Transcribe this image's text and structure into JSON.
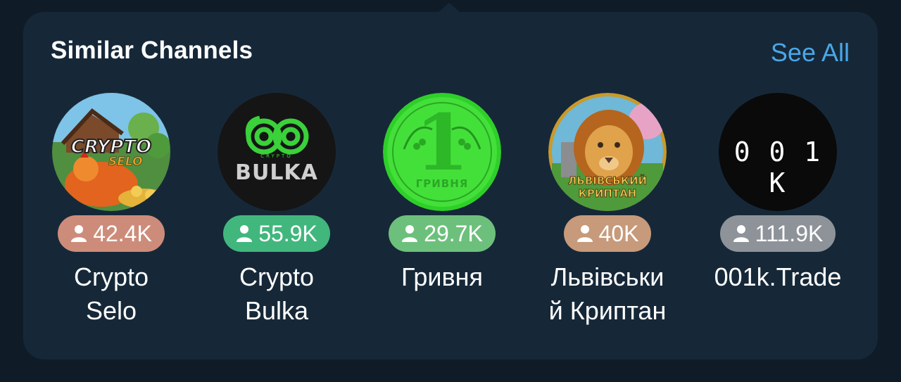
{
  "header": {
    "title": "Similar Channels",
    "see_all_label": "See All"
  },
  "colors": {
    "panel": "#162838",
    "accent": "#4aa7e8"
  },
  "channels": [
    {
      "name_line1": "Crypto",
      "name_line2": "Selo",
      "subscribers": "42.4K",
      "badge_color": "#cd8c7a",
      "avatar_text_1": "CRYPTO",
      "avatar_text_2": "SELO",
      "icon": "rooster-avatar"
    },
    {
      "name_line1": "Crypto",
      "name_line2": "Bulka",
      "subscribers": "55.9K",
      "badge_color": "#41b77d",
      "avatar_text_1": "BULKA",
      "avatar_text_2": "CRYPTO",
      "icon": "bulka-logo-avatar"
    },
    {
      "name_line1": "Гривня",
      "name_line2": "",
      "subscribers": "29.7K",
      "badge_color": "#6dc07c",
      "avatar_text_1": "1",
      "avatar_text_2": "ГРИВНЯ",
      "icon": "hryvnia-coin-avatar"
    },
    {
      "name_line1": "Львівськи",
      "name_line2": "й Криптан",
      "subscribers": "40K",
      "badge_color": "#c69a7a",
      "avatar_text_1": "ЛЬВІВСЬКИЙ",
      "avatar_text_2": "КРИПТАН",
      "icon": "lion-avatar"
    },
    {
      "name_line1": "001k.Trade",
      "name_line2": "",
      "subscribers": "111.9K",
      "badge_color": "#8e9399",
      "avatar_text_1": "0 0 1 K",
      "avatar_text_2": "",
      "icon": "001k-avatar"
    }
  ]
}
